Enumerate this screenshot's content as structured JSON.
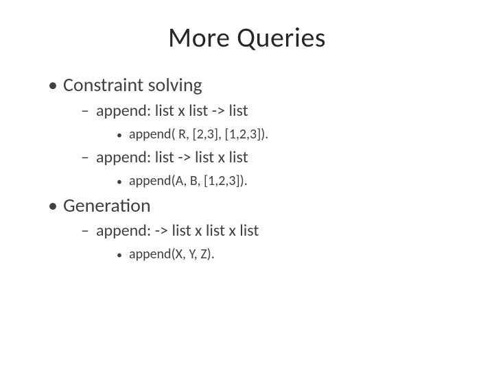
{
  "title": "More  Queries",
  "bullets": {
    "a": "Constraint solving",
    "a1": "append:  list x list -> list",
    "a1i": "append( R, [2,3], [1,2,3]).",
    "a2": "append:  list  ->  list x list",
    "a2i": "append(A, B, [1,2,3]).",
    "b": "Generation",
    "b1": "append:   ->  list x list  x list",
    "b1i": "append(X, Y, Z)."
  }
}
